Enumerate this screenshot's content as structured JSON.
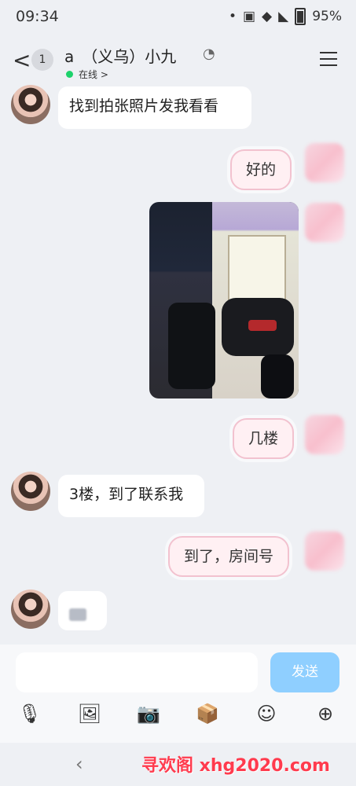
{
  "status_bar": {
    "time": "09:34",
    "battery": "95%"
  },
  "header": {
    "back": "<",
    "unread_count": "1",
    "title": "a　（义乌）小九",
    "status": "在线",
    "status_arrow": ">"
  },
  "messages": [
    {
      "side": "left",
      "text": "找到拍张照片发我看看"
    },
    {
      "side": "right",
      "text": "好的"
    },
    {
      "side": "right",
      "kind": "image"
    },
    {
      "side": "right",
      "text": "几楼"
    },
    {
      "side": "left",
      "text": "3楼，到了联系我"
    },
    {
      "side": "right",
      "text": "到了，房间号"
    },
    {
      "side": "left",
      "kind": "redacted"
    }
  ],
  "composer": {
    "send_label": "发送"
  },
  "toolbar": {
    "mic_icon": "🎙",
    "image_icon": "🖼",
    "camera_icon": "📷",
    "pocket_icon": "📦",
    "emoji_icon": "☺",
    "add_icon": "⊕"
  },
  "navigation": {
    "back": "‹"
  },
  "watermark": "寻欢阁 xhg2020.com"
}
